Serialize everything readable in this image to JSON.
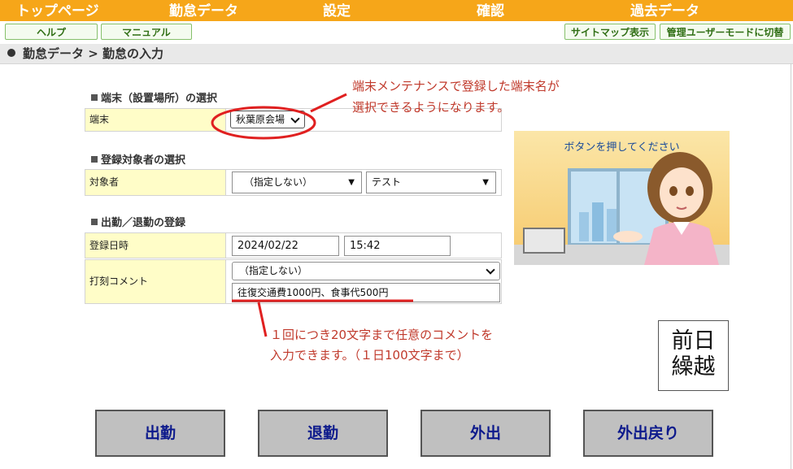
{
  "nav": {
    "top": "トップページ",
    "attendance": "勤怠データ",
    "settings": "設定",
    "confirm": "確認",
    "past": "過去データ"
  },
  "subnav": {
    "help": "ヘルプ",
    "manual": "マニュアル",
    "sitemap": "サイトマップ表示",
    "admin_mode": "管理ユーザーモードに切替"
  },
  "breadcrumb": "勤怠データ > 勤怠の入力",
  "terminal_section": {
    "title": "端末（設置場所）の選択",
    "label": "端末",
    "value": "秋葉原会場"
  },
  "target_section": {
    "title": "登録対象者の選択",
    "label": "対象者",
    "group_value": "（指定しない）",
    "person_value": "テスト"
  },
  "clock_section": {
    "title": "出勤／退勤の登録",
    "date_label": "登録日時",
    "date_value": "2024/02/22",
    "time_value": "15:42",
    "comment_label": "打刻コメント",
    "comment_select": "（指定しない）",
    "comment_text": "往復交通費1000円、食事代500円"
  },
  "annotations": {
    "terminal_line1": "端末メンテナンスで登録した端末名が",
    "terminal_line2": "選択できるようになります。",
    "comment_line1": "１回につき20文字まで任意のコメントを",
    "comment_line2": "入力できます。（１日100文字まで）"
  },
  "illustration": {
    "caption": "ボタンを押してください"
  },
  "previous_day": {
    "line1": "前日",
    "line2": "繰越"
  },
  "actions": {
    "clock_in": "出勤",
    "clock_out": "退勤",
    "go_out": "外出",
    "return": "外出戻り"
  },
  "colors": {
    "nav_bg": "#f6a619",
    "label_bg": "#fffdc8",
    "annotation": "#c0392b",
    "action_text": "#0d1a8c"
  }
}
